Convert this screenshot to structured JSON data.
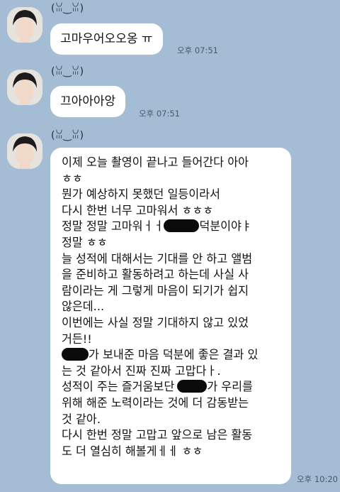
{
  "chat": {
    "messages": [
      {
        "sender": "(ꈍ‿ꈍ)",
        "text": "고마우어오오옹 ㅠ",
        "time": "오후 07:51"
      },
      {
        "sender": "(ꈍ‿ꈍ)",
        "text": "끄아아아앙",
        "time": "오후 07:51"
      },
      {
        "sender": "(ꈍ‿ꈍ)",
        "time": "오후 10:20",
        "lines": [
          "이제 오늘 촬영이 끝나고 들어간다 아아",
          "ㅎㅎ",
          "뭔가 예상하지 못했던 일등이라서",
          "다시 한번 너무 고마워서 ㅎㅎㅎ",
          "정말 정말 고마워ㅓㅓ",
          "덕분이야ㅑ",
          "정말 ㅎㅎ",
          "늘 성적에 대해서는 기대를 안 하고 앨범",
          "을 준비하고 활동하려고 하는데 사실 사",
          "람이라는 게 그렇게 마음이 되기가 쉽지",
          "않은데...",
          "이번에는 사실 정말 기대하지 않고 있었",
          "거든!!",
          "가 보내준 마음 덕분에 좋은 결과 있",
          "는 것 같아서 진짜 진짜 고맙다ㅏ.",
          "성적이 주는 즐거움보단",
          "가 우리를",
          "위해 해준 노력이라는 것에 더 감동받는",
          "것 같아.",
          "다시 한번 정말 고맙고 앞으로 남은 활동",
          "도 더 열심히 해볼게ㅔㅔ ㅎㅎ"
        ]
      }
    ]
  },
  "colors": {
    "background": "#a4bcd4",
    "bubble": "#ffffff",
    "redaction": "#0b0b0b"
  }
}
